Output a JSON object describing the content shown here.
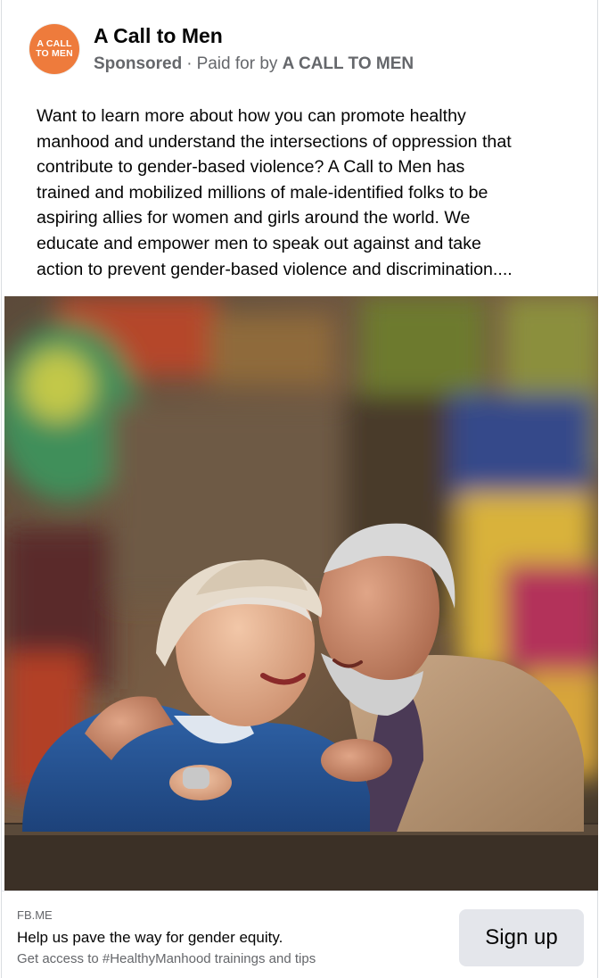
{
  "header": {
    "avatar_line1": "A CALL",
    "avatar_line2": "TO MEN",
    "page_name": "A Call to Men",
    "sponsored_label": "Sponsored",
    "separator": "·",
    "paid_for_prefix": "Paid for by",
    "paid_for_name": "A CALL TO MEN"
  },
  "post": {
    "text_lines": [
      "Want to learn more about how you can promote healthy",
      "manhood and understand the intersections of oppression that",
      "contribute to gender-based violence? A Call to Men has",
      "trained and mobilized millions of male-identified folks to be",
      "aspiring allies for women and girls around the world. We",
      "educate and empower men to speak out against and take",
      "action to prevent gender-based violence and discrimination...."
    ]
  },
  "link_preview": {
    "domain": "FB.ME",
    "title": "Help us pave the way for gender equity.",
    "description": "Get access to #HealthyManhood trainings and tips",
    "cta_label": "Sign up"
  },
  "colors": {
    "avatar_bg": "#ee7b3c",
    "secondary_text": "#65676b",
    "button_bg": "#e4e6eb"
  }
}
